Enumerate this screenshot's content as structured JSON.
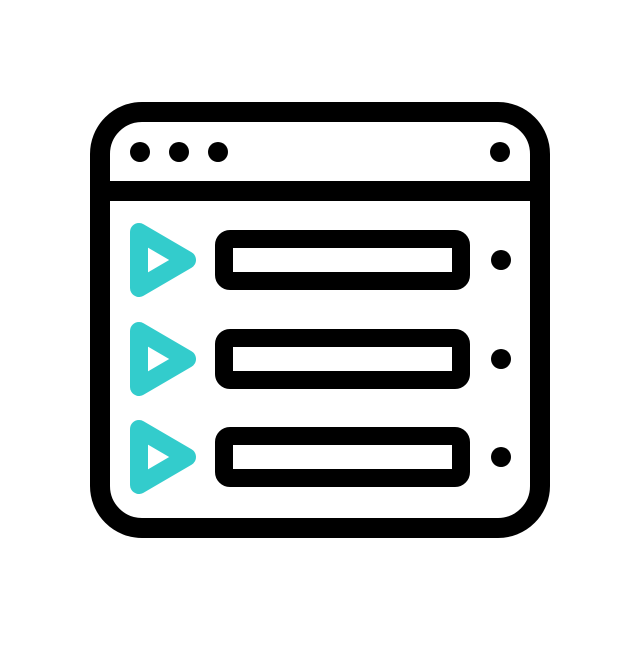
{
  "icon": {
    "name": "video-playlist-window-icon",
    "stroke_color": "#000000",
    "accent_color": "#33CCCC",
    "background_color": "#FFFFFF"
  },
  "window": {
    "titlebar_dots_left": [
      "dot",
      "dot",
      "dot"
    ],
    "titlebar_dot_right": "dot"
  },
  "playlist": {
    "items": [
      {
        "icon": "play-icon",
        "bar": "text-bar",
        "indicator": "dot"
      },
      {
        "icon": "play-icon",
        "bar": "text-bar",
        "indicator": "dot"
      },
      {
        "icon": "play-icon",
        "bar": "text-bar",
        "indicator": "dot"
      }
    ]
  }
}
